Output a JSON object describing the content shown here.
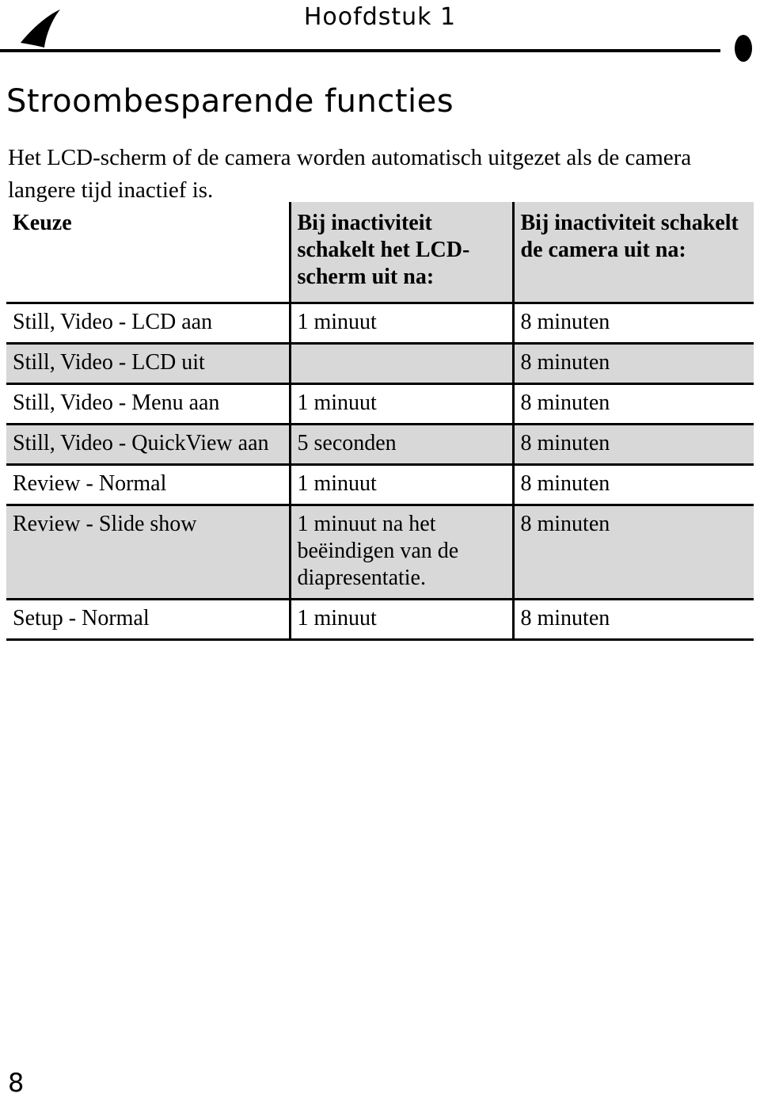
{
  "header": {
    "chapter": "Hoofdstuk 1",
    "arrow_icon": "back-arrow-icon",
    "dot_icon": "page-marker-dot-icon"
  },
  "title": "Stroombesparende functies",
  "intro": "Het LCD-scherm of de camera worden automatisch uitgezet als de camera langere tijd inactief is.",
  "table": {
    "headers": {
      "col_a": "Keuze",
      "col_b": "Bij inactiviteit schakelt het LCD-scherm uit na:",
      "col_c": "Bij inactiviteit schakelt de camera uit na:"
    },
    "rows": [
      {
        "choice": "Still, Video - LCD aan",
        "lcd": "1 minuut",
        "camera": "8 minuten"
      },
      {
        "choice": "Still, Video - LCD uit",
        "lcd": "",
        "camera": "8 minuten"
      },
      {
        "choice": "Still, Video - Menu aan",
        "lcd": "1 minuut",
        "camera": "8 minuten"
      },
      {
        "choice": "Still, Video - QuickView aan",
        "lcd": "5 seconden",
        "camera": "8 minuten"
      },
      {
        "choice": "Review - Normal",
        "lcd": "1 minuut",
        "camera": "8 minuten"
      },
      {
        "choice": "Review - Slide show",
        "lcd": "1 minuut na het beëindigen van de diapresentatie.",
        "camera": "8 minuten"
      },
      {
        "choice": "Setup - Normal",
        "lcd": "1 minuut",
        "camera": "8 minuten"
      }
    ]
  },
  "footer": {
    "page_number": "8"
  }
}
